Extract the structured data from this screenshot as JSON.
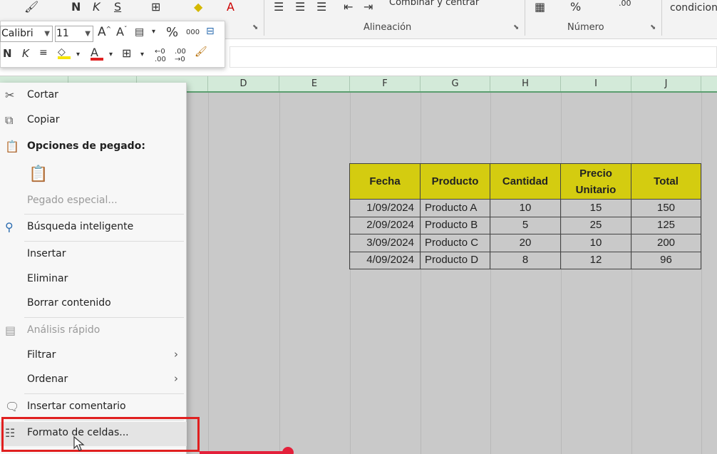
{
  "ribbon": {
    "merge_label": "Combinar y centrar",
    "conditional_label": "condicion",
    "groups": {
      "alignment": "Alineación",
      "number": "Número"
    }
  },
  "mini_toolbar": {
    "font": "Calibri",
    "font_size": "11",
    "bold": "N",
    "italic": "K",
    "font_color": "#e02020",
    "highlight_color": "#f7e500"
  },
  "columns": [
    "D",
    "E",
    "F",
    "G",
    "H",
    "I",
    "J"
  ],
  "table": {
    "headers": [
      "Fecha",
      "Producto",
      "Cantidad",
      "Precio Unitario",
      "Total"
    ],
    "header_line1": "Precio",
    "header_line2": "Unitario",
    "rows": [
      [
        "1/09/2024",
        "Producto A",
        "10",
        "15",
        "150"
      ],
      [
        "2/09/2024",
        "Producto B",
        "5",
        "25",
        "125"
      ],
      [
        "3/09/2024",
        "Producto C",
        "20",
        "10",
        "200"
      ],
      [
        "4/09/2024",
        "Producto D",
        "8",
        "12",
        "96"
      ]
    ],
    "header_color": "#d4cc10"
  },
  "context_menu": {
    "cut": "Cortar",
    "copy": "Copiar",
    "paste_options": "Opciones de pegado:",
    "paste_special": "Pegado especial...",
    "smart_lookup": "Búsqueda inteligente",
    "insert": "Insertar",
    "delete": "Eliminar",
    "clear": "Borrar contenido",
    "quick_analysis": "Análisis rápido",
    "filter": "Filtrar",
    "sort": "Ordenar",
    "insert_comment": "Insertar comentario",
    "format_cells": "Formato de celdas..."
  }
}
